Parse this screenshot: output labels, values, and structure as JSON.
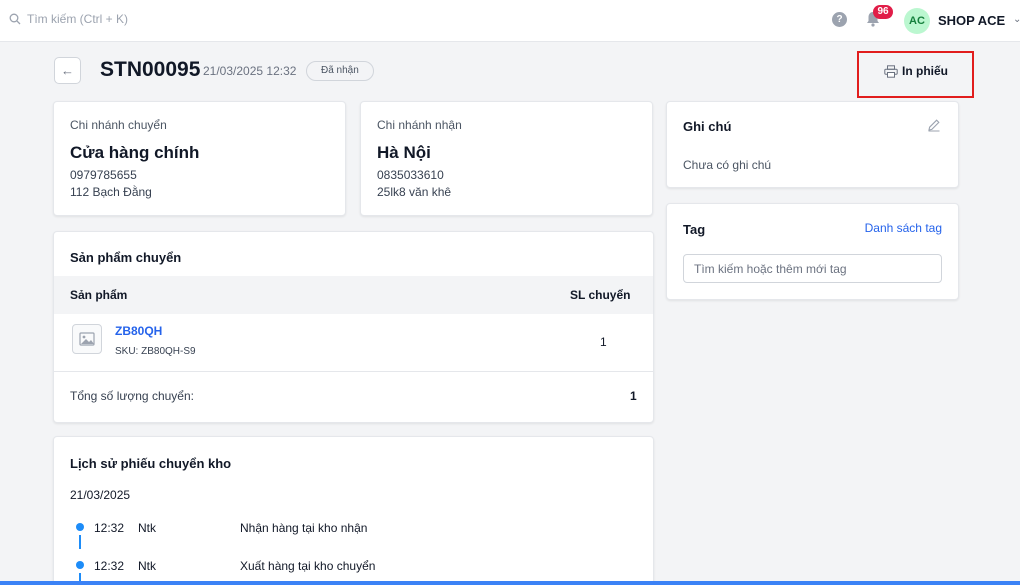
{
  "topbar": {
    "search_placeholder": "Tìm kiếm (Ctrl + K)",
    "help_glyph": "?",
    "notification_count": "96",
    "avatar_initials": "AC",
    "shop_name": "SHOP ACE"
  },
  "header": {
    "back_glyph": "←",
    "code": "STN00095",
    "datetime": "21/03/2025 12:32",
    "status": "Đã nhận",
    "print_label": "In phiếu"
  },
  "from_branch": {
    "label": "Chi nhánh chuyển",
    "name": "Cửa hàng chính",
    "phone": "0979785655",
    "address": "112 Bạch Đằng"
  },
  "to_branch": {
    "label": "Chi nhánh nhận",
    "name": "Hà Nội",
    "phone": "0835033610",
    "address": "25lk8 văn khê"
  },
  "products": {
    "title": "Sản phẩm chuyển",
    "col_product": "Sản phẩm",
    "col_qty": "SL chuyển",
    "items": [
      {
        "name": "ZB80QH",
        "sku": "SKU: ZB80QH-S9",
        "qty": "1"
      }
    ],
    "total_label": "Tổng số lượng chuyển:",
    "total_value": "1"
  },
  "history": {
    "title": "Lịch sử phiếu chuyển kho",
    "date": "21/03/2025",
    "events": [
      {
        "time": "12:32",
        "user": "Ntk",
        "action": "Nhận hàng tại kho nhận"
      },
      {
        "time": "12:32",
        "user": "Ntk",
        "action": "Xuất hàng tại kho chuyển"
      }
    ]
  },
  "note": {
    "title": "Ghi chú",
    "empty_text": "Chưa có ghi chú"
  },
  "tag": {
    "title": "Tag",
    "list_link": "Danh sách tag",
    "input_placeholder": "Tìm kiếm hoặc thêm mới tag"
  },
  "colors": {
    "accent": "#1d8cf8",
    "link": "#2563eb",
    "highlight_border": "#e11d1d",
    "badge": "#e11d48"
  }
}
